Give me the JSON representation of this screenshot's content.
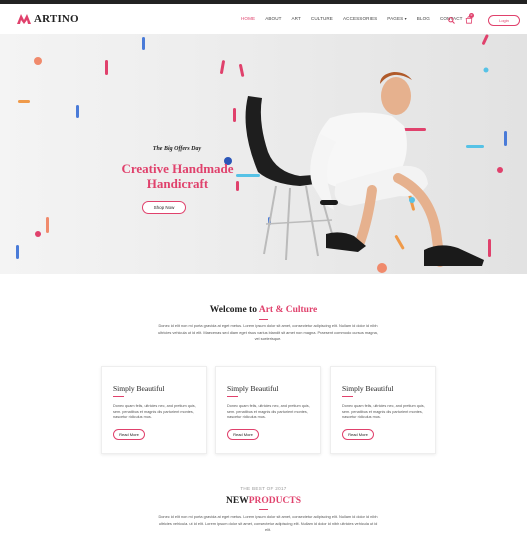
{
  "brand": {
    "name": "ARTINO",
    "accent": "#e0416c"
  },
  "nav": {
    "items": [
      {
        "label": "HOME",
        "active": true
      },
      {
        "label": "ABOUT",
        "active": false
      },
      {
        "label": "ART",
        "active": false
      },
      {
        "label": "CULTURE",
        "active": false
      },
      {
        "label": "ACCESSORIES",
        "active": false
      },
      {
        "label": "PAGES",
        "active": false,
        "caret": "▾"
      },
      {
        "label": "BLOG",
        "active": false
      },
      {
        "label": "CONTACT",
        "active": false
      }
    ],
    "cart_count": "0",
    "login_label": "Login",
    "icons": [
      "search-icon",
      "cart-icon"
    ]
  },
  "hero": {
    "tagline": "The Big Offers Day",
    "title_line1": "Creative Handmade",
    "title_line2": "Handicraft",
    "button": "Shop Now"
  },
  "welcome": {
    "title_prefix": "Welcome to",
    "title_accent": "Art & Culture",
    "text": "Donec id elit non mi porta gravida at eget metus. Lorem ipsum dolor sit amet, consectetur adipiscing elit. Nullam id dolor id nibh ultricies vehicula ut id elit. Maecenas sed diam eget risus varius blandit sit amet non magna. Praesent commodo cursus magna, vel scelerisque."
  },
  "cards": [
    {
      "title": "Simply Beautiful",
      "text": "Donec quam felis, ultricies nec, and pretium quis, sem. penatibus et magnis dis parturient montes, nascetur ridiculus mus.",
      "button": "Read More"
    },
    {
      "title": "Simply Beautiful",
      "text": "Donec quam felis, ultricies nec, and pretium quis, sem. penatibus et magnis dis parturient montes, nascetur ridiculus mus.",
      "button": "Read More"
    },
    {
      "title": "Simply Beautiful",
      "text": "Donec quam felis, ultricies nec, and pretium quis, sem. penatibus et magnis dis parturient montes, nascetur ridiculus mus.",
      "button": "Read More"
    }
  ],
  "products": {
    "kicker": "THE BEST OF 2017",
    "title_prefix": "NEW",
    "title_accent": "PRODUCTS",
    "text": "Donec id elit non mi porta gravida at eget metus. Lorem ipsum dolor sit amet, consectetur adipiscing elit. Nullam id dolor id nibh ultricies vehicula. ut id elit. Lorem ipsum dolor sit amet, consectetur adipiscing elit. Nullam id dolor id nibh ultricies vehicula ut id elit."
  }
}
